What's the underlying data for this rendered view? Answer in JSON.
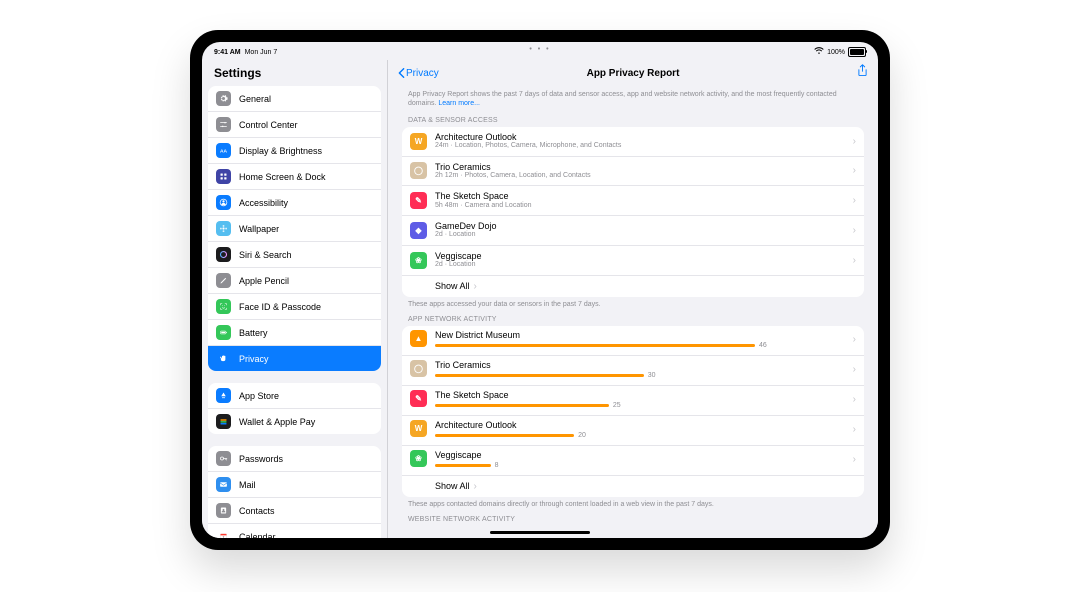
{
  "status": {
    "time": "9:41 AM",
    "date": "Mon Jun 7",
    "battery": "100%",
    "dots": "• • •",
    "wifi": "wifi"
  },
  "sidebar": {
    "title": "Settings",
    "groups": [
      {
        "items": [
          {
            "label": "General",
            "icon": "gear",
            "bg": "#8e8e93"
          },
          {
            "label": "Control Center",
            "icon": "sliders",
            "bg": "#8e8e93"
          },
          {
            "label": "Display & Brightness",
            "icon": "brightness",
            "bg": "#0a7cff"
          },
          {
            "label": "Home Screen & Dock",
            "icon": "grid",
            "bg": "#3f44a6"
          },
          {
            "label": "Accessibility",
            "icon": "person",
            "bg": "#0a7cff"
          },
          {
            "label": "Wallpaper",
            "icon": "flower",
            "bg": "#55bef0"
          },
          {
            "label": "Siri & Search",
            "icon": "siri",
            "bg": "#1c1c1e"
          },
          {
            "label": "Apple Pencil",
            "icon": "pencil",
            "bg": "#8e8e93"
          },
          {
            "label": "Face ID & Passcode",
            "icon": "faceid",
            "bg": "#34c759"
          },
          {
            "label": "Battery",
            "icon": "battery",
            "bg": "#34c759"
          },
          {
            "label": "Privacy",
            "icon": "hand",
            "bg": "#0a7cff",
            "selected": true
          }
        ]
      },
      {
        "items": [
          {
            "label": "App Store",
            "icon": "appstore",
            "bg": "#0a7cff"
          },
          {
            "label": "Wallet & Apple Pay",
            "icon": "wallet",
            "bg": "#1c1c1e"
          }
        ]
      },
      {
        "items": [
          {
            "label": "Passwords",
            "icon": "key",
            "bg": "#8e8e93"
          },
          {
            "label": "Mail",
            "icon": "mail",
            "bg": "#2f8fef"
          },
          {
            "label": "Contacts",
            "icon": "contacts",
            "bg": "#8e8e93"
          },
          {
            "label": "Calendar",
            "icon": "calendar",
            "bg": "#ffffff",
            "fg": "#ff3b30"
          }
        ]
      }
    ]
  },
  "main": {
    "back": "Privacy",
    "title": "App Privacy Report",
    "intro_text": "App Privacy Report shows the past 7 days of data and sensor access, app and website network activity, and the most frequently contacted domains. ",
    "intro_link": "Learn more...",
    "sections": {
      "sensor": {
        "header": "DATA & SENSOR ACCESS",
        "items": [
          {
            "name": "Architecture Outlook",
            "sub": "24m · Location, Photos, Camera, Microphone, and Contacts",
            "bg": "#f5a623",
            "glyph": "W"
          },
          {
            "name": "Trio Ceramics",
            "sub": "2h 12m · Photos, Camera, Location, and Contacts",
            "bg": "#d8c3a5",
            "glyph": "◯"
          },
          {
            "name": "The Sketch Space",
            "sub": "5h 48m · Camera and Location",
            "bg": "#ff2d55",
            "glyph": "✎"
          },
          {
            "name": "GameDev Dojo",
            "sub": "2d · Location",
            "bg": "#5e5ce6",
            "glyph": "◆"
          },
          {
            "name": "Veggiscape",
            "sub": "2d · Location",
            "bg": "#34c759",
            "glyph": "❀"
          }
        ],
        "show_all": "Show All",
        "footnote": "These apps accessed your data or sensors in the past 7 days."
      },
      "appnet": {
        "header": "APP NETWORK ACTIVITY",
        "items": [
          {
            "name": "New District Museum",
            "value": 46,
            "bg": "#ff9500",
            "glyph": "▲"
          },
          {
            "name": "Trio Ceramics",
            "value": 30,
            "bg": "#d8c3a5",
            "glyph": "◯"
          },
          {
            "name": "The Sketch Space",
            "value": 25,
            "bg": "#ff2d55",
            "glyph": "✎"
          },
          {
            "name": "Architecture Outlook",
            "value": 20,
            "bg": "#f5a623",
            "glyph": "W"
          },
          {
            "name": "Veggiscape",
            "value": 8,
            "bg": "#34c759",
            "glyph": "❀"
          }
        ],
        "show_all": "Show All",
        "footnote": "These apps contacted domains directly or through content loaded in a web view in the past 7 days.",
        "bar_max": 46,
        "bar_full_width": 320
      },
      "webnet": {
        "header": "WEBSITE NETWORK ACTIVITY"
      }
    }
  }
}
